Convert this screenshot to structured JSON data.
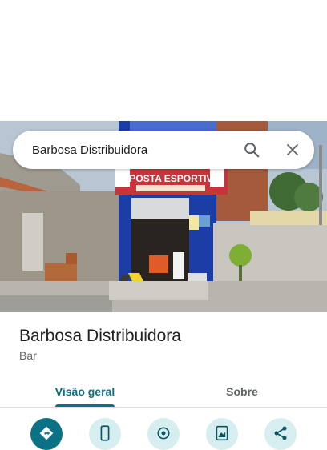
{
  "search": {
    "query": "Barbosa Distribuidora",
    "search_icon": "search-icon",
    "close_icon": "close-icon"
  },
  "photo": {
    "sign_text": "APOSTA ESPORTIVA"
  },
  "place": {
    "name": "Barbosa Distribuidora",
    "category": "Bar"
  },
  "tabs": [
    {
      "label": "Visão geral",
      "active": true
    },
    {
      "label": "Sobre",
      "active": false
    }
  ],
  "actions": [
    {
      "icon": "directions-icon"
    },
    {
      "icon": "phone-icon"
    },
    {
      "icon": "location-pin-icon"
    },
    {
      "icon": "add-photo-icon"
    },
    {
      "icon": "share-icon"
    }
  ],
  "colors": {
    "accent": "#0b7285",
    "accent_light": "#d7eef0"
  }
}
